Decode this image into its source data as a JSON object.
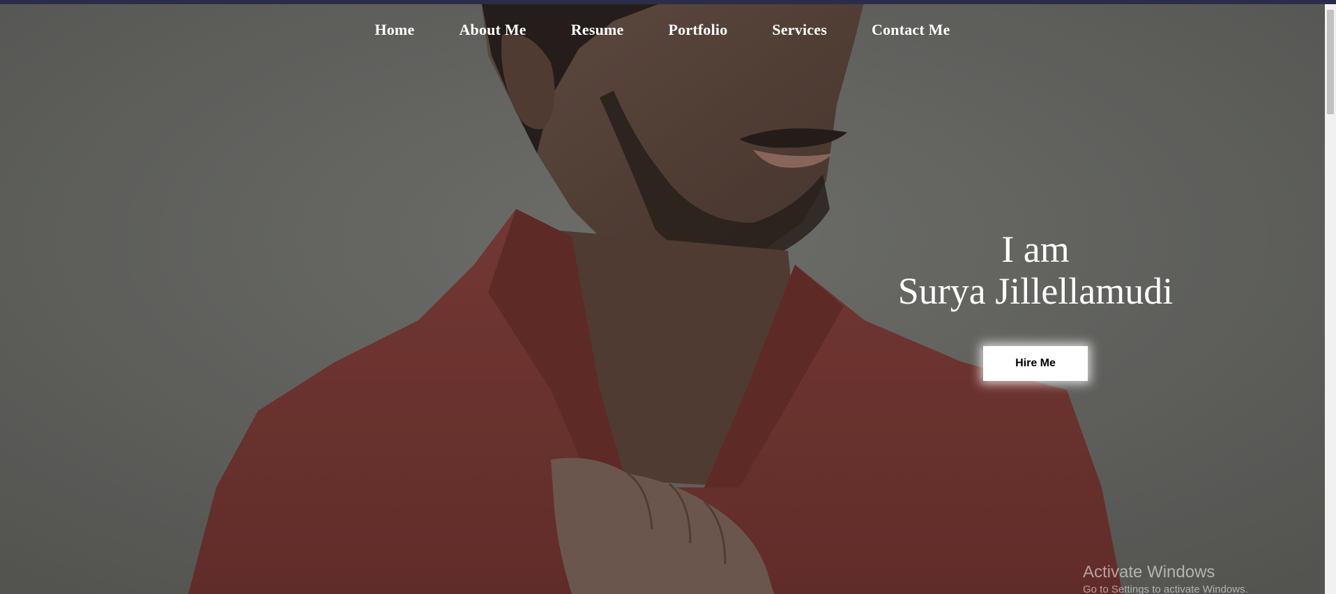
{
  "nav": {
    "items": [
      {
        "label": "Home"
      },
      {
        "label": "About Me"
      },
      {
        "label": "Resume"
      },
      {
        "label": "Portfolio"
      },
      {
        "label": "Services"
      },
      {
        "label": "Contact Me"
      }
    ]
  },
  "hero": {
    "line1": "I am",
    "line2": "Surya Jillellamudi",
    "button_label": "Hire Me"
  },
  "watermark": {
    "title": "Activate Windows",
    "subtitle": "Go to Settings to activate Windows."
  },
  "colors": {
    "top_strip": "#2b2d48",
    "background": "#6a6b67",
    "shirt": "#7e3a36",
    "text": "#ffffff",
    "button_bg": "#ffffff"
  },
  "icons": {
    "background": "portrait-photo"
  }
}
